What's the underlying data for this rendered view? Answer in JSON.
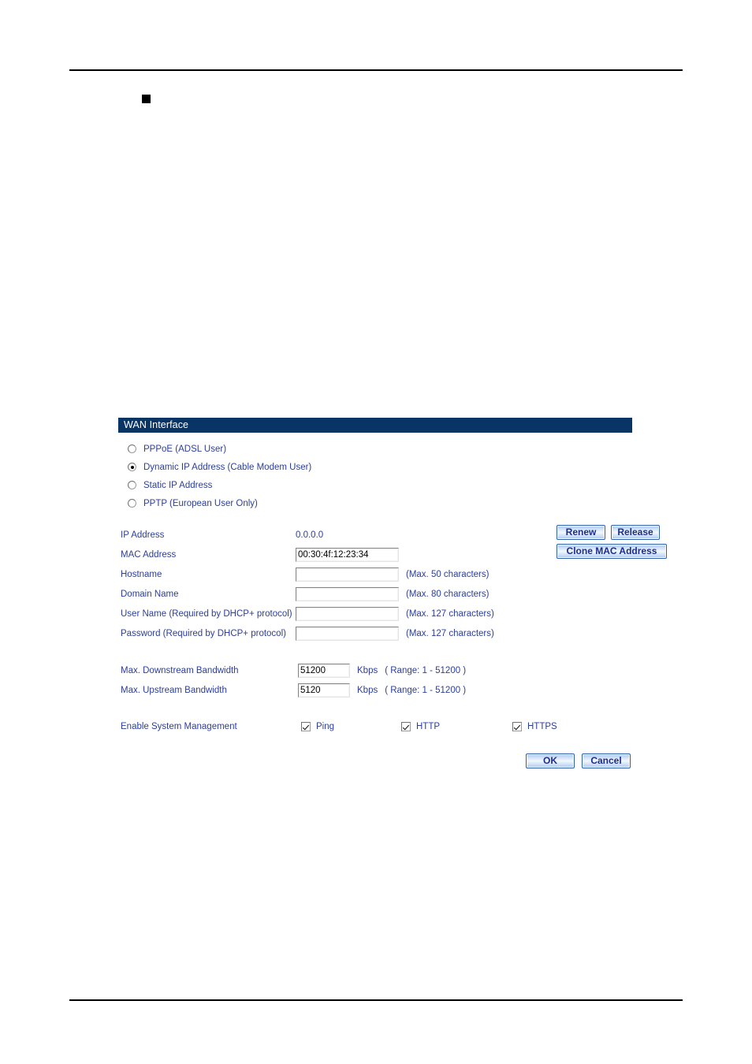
{
  "panel": {
    "title": "WAN Interface",
    "connection_modes": [
      {
        "label": "PPPoE (ADSL User)",
        "selected": false
      },
      {
        "label": "Dynamic IP Address (Cable Modem User)",
        "selected": true
      },
      {
        "label": "Static IP Address",
        "selected": false
      },
      {
        "label": "PPTP (European User Only)",
        "selected": false
      }
    ],
    "fields": {
      "ip_address": {
        "label": "IP Address",
        "value": "0.0.0.0"
      },
      "mac_address": {
        "label": "MAC Address",
        "value": "00:30:4f:12:23:34"
      },
      "hostname": {
        "label": "Hostname",
        "value": "",
        "hint": "(Max. 50 characters)"
      },
      "domain_name": {
        "label": "Domain Name",
        "value": "",
        "hint": "(Max. 80 characters)"
      },
      "user_name": {
        "label": "User Name (Required by DHCP+ protocol)",
        "value": "",
        "hint": "(Max. 127 characters)"
      },
      "password": {
        "label": "Password (Required by DHCP+ protocol)",
        "value": "",
        "hint": "(Max. 127 characters)"
      }
    },
    "buttons": {
      "renew": "Renew",
      "release": "Release",
      "clone_mac": "Clone MAC Address",
      "ok": "OK",
      "cancel": "Cancel"
    },
    "bandwidth": {
      "downstream": {
        "label": "Max. Downstream Bandwidth",
        "value": "51200",
        "unit": "Kbps",
        "range": "( Range: 1 - 51200 )"
      },
      "upstream": {
        "label": "Max. Upstream Bandwidth",
        "value": "5120",
        "unit": "Kbps",
        "range": "( Range: 1 - 51200 )"
      }
    },
    "system_management": {
      "label": "Enable System Management",
      "options": [
        {
          "label": "Ping",
          "checked": true
        },
        {
          "label": "HTTP",
          "checked": true
        },
        {
          "label": "HTTPS",
          "checked": true
        }
      ]
    }
  },
  "colors": {
    "title_bar": "#083566",
    "label_text": "#2c3e9b",
    "button_text": "#1a2d8f"
  }
}
